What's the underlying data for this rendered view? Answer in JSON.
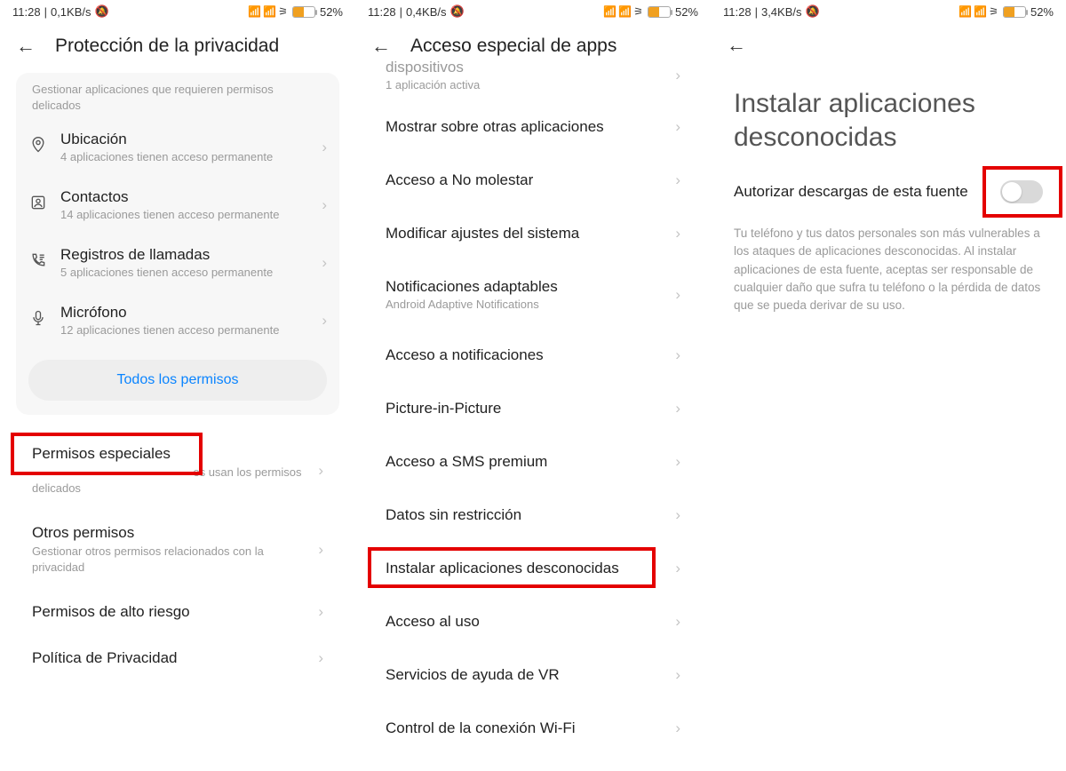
{
  "screens": [
    {
      "status": {
        "time": "11:28",
        "speed": "0,1KB/s",
        "battery": "52%"
      },
      "header": {
        "title": "Protección de la privacidad"
      },
      "card": {
        "intro": "Gestionar aplicaciones que requieren permisos delicados",
        "items": [
          {
            "icon": "location",
            "title": "Ubicación",
            "sub": "4 aplicaciones tienen acceso permanente"
          },
          {
            "icon": "contacts",
            "title": "Contactos",
            "sub": "14 aplicaciones tienen acceso permanente"
          },
          {
            "icon": "calllog",
            "title": "Registros de llamadas",
            "sub": "5 aplicaciones tienen acceso permanente"
          },
          {
            "icon": "mic",
            "title": "Micrófono",
            "sub": "12 aplicaciones tienen acceso permanente"
          }
        ],
        "button": "Todos los permisos"
      },
      "flat": [
        {
          "title": "Permisos especiales",
          "sub": "Monitorizar cómo las aplicaciones usan los permisos delicados",
          "highlight": true
        },
        {
          "title": "Otros permisos",
          "sub": "Gestionar otros permisos relacionados con la privacidad"
        },
        {
          "title": "Permisos de alto riesgo",
          "sub": ""
        },
        {
          "title": "Política de Privacidad",
          "sub": ""
        }
      ]
    },
    {
      "status": {
        "time": "11:28",
        "speed": "0,4KB/s",
        "battery": "52%"
      },
      "header": {
        "title": "Acceso especial de apps"
      },
      "topcut": {
        "title": "dispositivos",
        "sub": "1 aplicación activa"
      },
      "list": [
        {
          "title": "Mostrar sobre otras aplicaciones"
        },
        {
          "title": "Acceso a No molestar"
        },
        {
          "title": "Modificar ajustes del sistema"
        },
        {
          "title": "Notificaciones adaptables",
          "sub": "Android Adaptive Notifications"
        },
        {
          "title": "Acceso a notificaciones"
        },
        {
          "title": "Picture-in-Picture"
        },
        {
          "title": "Acceso a SMS premium"
        },
        {
          "title": "Datos sin restricción"
        },
        {
          "title": "Instalar aplicaciones desconocidas",
          "highlight": true
        },
        {
          "title": "Acceso al uso"
        },
        {
          "title": "Servicios de ayuda de VR"
        },
        {
          "title": "Control de la conexión Wi-Fi"
        }
      ]
    },
    {
      "status": {
        "time": "11:28",
        "speed": "3,4KB/s",
        "battery": "52%"
      },
      "bigtitle": "Instalar aplicaciones desconocidas",
      "toggle": {
        "label": "Autorizar descargas de esta fuente",
        "on": false,
        "highlight": true
      },
      "desc": "Tu teléfono y tus datos personales son más vulnerables a los ataques de aplicaciones desconocidas. Al instalar aplicaciones de esta fuente, aceptas ser responsable de cualquier daño que sufra tu teléfono o la pérdida de datos que se pueda derivar de su uso."
    }
  ]
}
